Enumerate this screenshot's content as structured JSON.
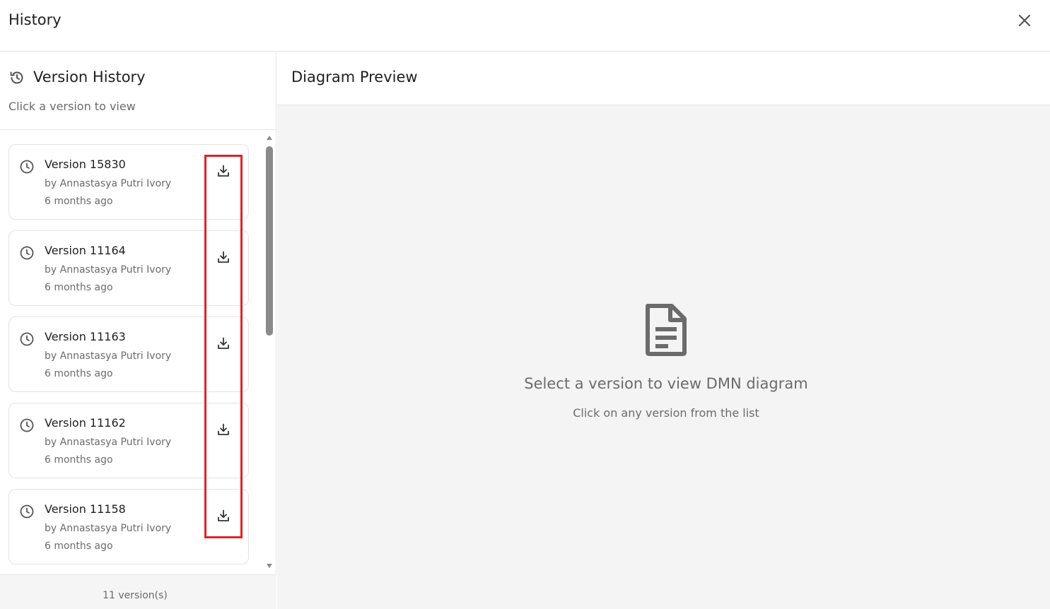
{
  "header": {
    "title": "History"
  },
  "sidebar": {
    "title": "Version History",
    "subtitle": "Click a version to view",
    "versions": [
      {
        "label": "Version 15830",
        "author": "by Annastasya Putri Ivory",
        "time": "6 months ago"
      },
      {
        "label": "Version 11164",
        "author": "by Annastasya Putri Ivory",
        "time": "6 months ago"
      },
      {
        "label": "Version 11163",
        "author": "by Annastasya Putri Ivory",
        "time": "6 months ago"
      },
      {
        "label": "Version 11162",
        "author": "by Annastasya Putri Ivory",
        "time": "6 months ago"
      },
      {
        "label": "Version 11158",
        "author": "by Annastasya Putri Ivory",
        "time": "6 months ago"
      }
    ],
    "footer": "11 version(s)"
  },
  "preview": {
    "title": "Diagram Preview",
    "empty_title": "Select a version to view DMN diagram",
    "empty_subtitle": "Click on any version from the list"
  },
  "colors": {
    "highlight": "#d9262c",
    "preview_bg": "#f4f4f4",
    "muted_text": "#6b6b6b"
  },
  "icons": {
    "close": "close-icon",
    "history": "history-icon",
    "clock": "clock-icon",
    "download": "download-icon",
    "document": "document-icon"
  }
}
